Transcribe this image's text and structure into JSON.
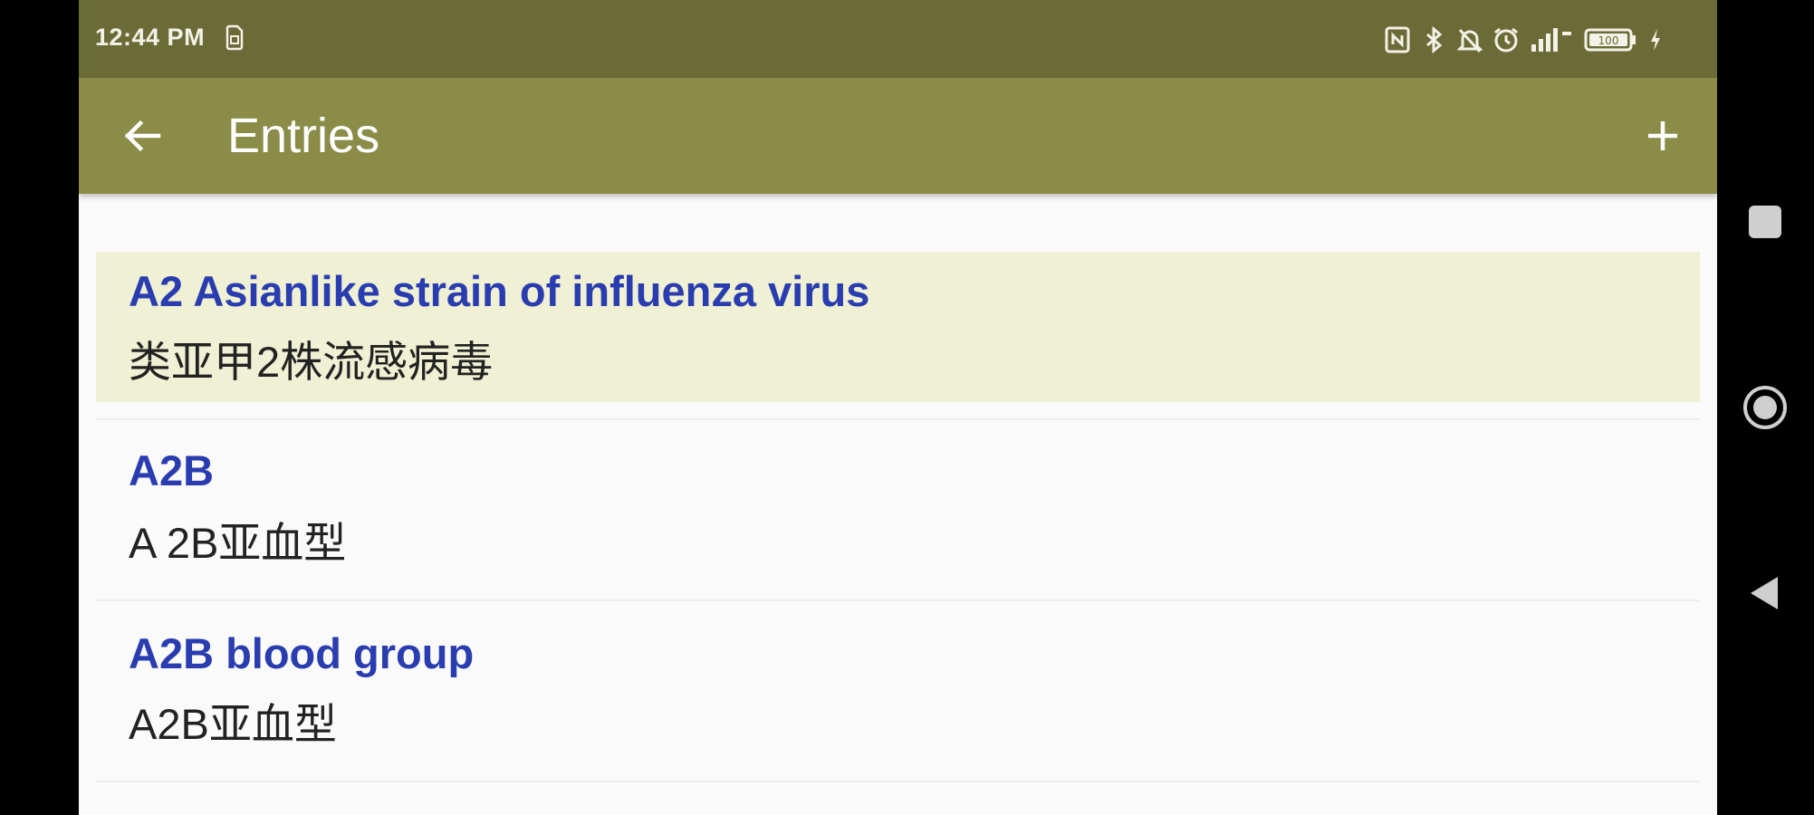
{
  "status_bar": {
    "time": "12:44 PM",
    "icons": [
      "sim-card-icon",
      "nfc-icon",
      "bluetooth-icon",
      "mute-icon",
      "alarm-icon",
      "signal-icon",
      "battery-icon",
      "charging-icon"
    ],
    "battery_level": "100"
  },
  "app_bar": {
    "back_icon": "arrow-left-icon",
    "title": "Entries",
    "add_icon": "plus-icon"
  },
  "entries": [
    {
      "term": "A2 Asianlike strain of influenza virus",
      "translation": "类亚甲2株流感病毒",
      "selected": true
    },
    {
      "term": "A2B",
      "translation": "A 2B亚血型",
      "selected": false
    },
    {
      "term": "A2B blood group",
      "translation": "A2B亚血型",
      "selected": false
    }
  ],
  "navigation_bar": {
    "buttons": [
      "recents-square-icon",
      "home-circle-icon",
      "back-triangle-icon"
    ]
  },
  "colors": {
    "status_bar": "#6b6b38",
    "app_bar": "#8a8c48",
    "term_text": "#2a3db0",
    "selected_row": "#f0f0d4"
  }
}
